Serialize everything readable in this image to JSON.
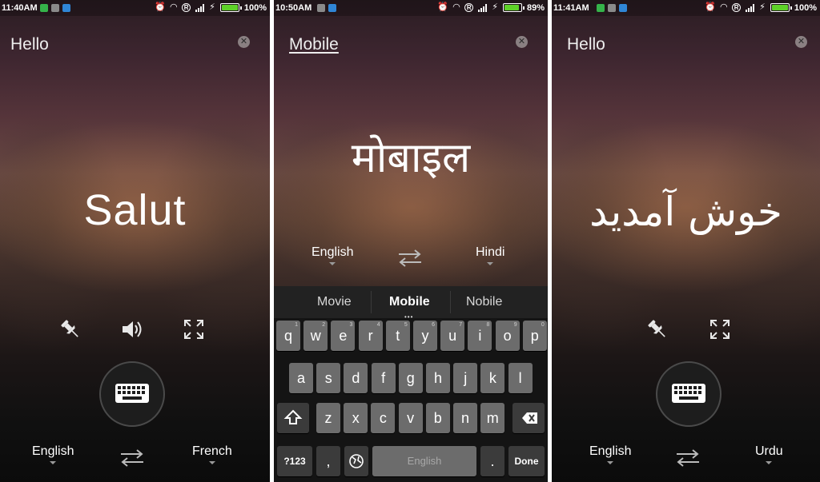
{
  "colors": {
    "battery_green": "#5ed128",
    "key_bg": "#6c6c6c",
    "suggestion_bar": "#222222"
  },
  "screens": [
    {
      "status": {
        "time": "11:40AM",
        "battery": "100%",
        "battery_level": 1.0
      },
      "source_text": "Hello",
      "translation": "Salut",
      "source_language": "English",
      "target_language": "French",
      "actions": [
        "pin-icon",
        "speaker-icon",
        "fullscreen-icon"
      ]
    },
    {
      "status": {
        "time": "10:50AM",
        "battery": "89%",
        "battery_level": 0.89
      },
      "source_text": "Mobile",
      "translation": "मोबाइल",
      "source_language": "English",
      "target_language": "Hindi",
      "keyboard": {
        "suggestions": [
          "Movie",
          "Mobile",
          "Nobile"
        ],
        "row1": [
          {
            "key": "q",
            "hint": "1"
          },
          {
            "key": "w",
            "hint": "2"
          },
          {
            "key": "e",
            "hint": "3"
          },
          {
            "key": "r",
            "hint": "4"
          },
          {
            "key": "t",
            "hint": "5"
          },
          {
            "key": "y",
            "hint": "6"
          },
          {
            "key": "u",
            "hint": "7"
          },
          {
            "key": "i",
            "hint": "8"
          },
          {
            "key": "o",
            "hint": "9"
          },
          {
            "key": "p",
            "hint": "0"
          }
        ],
        "row2": [
          "a",
          "s",
          "d",
          "f",
          "g",
          "h",
          "j",
          "k",
          "l"
        ],
        "row3": [
          "z",
          "x",
          "c",
          "v",
          "b",
          "n",
          "m"
        ],
        "symbols_label": "?123",
        "comma_label": ",",
        "space_label": "English",
        "period_label": ".",
        "done_label": "Done"
      }
    },
    {
      "status": {
        "time": "11:41AM",
        "battery": "100%",
        "battery_level": 1.0
      },
      "source_text": "Hello",
      "translation": "خوش آمدید",
      "source_language": "English",
      "target_language": "Urdu",
      "actions": [
        "pin-icon",
        "fullscreen-icon"
      ]
    }
  ]
}
